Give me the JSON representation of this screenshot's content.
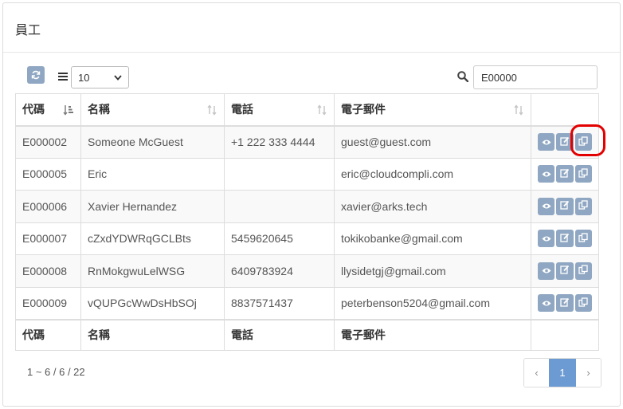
{
  "panel": {
    "title": "員工"
  },
  "toolbar": {
    "page_size": "10",
    "search_value": "E00000"
  },
  "table": {
    "columns": [
      "代碼",
      "名稱",
      "電話",
      "電子郵件"
    ],
    "rows": [
      {
        "code": "E000002",
        "name": "Someone McGuest",
        "phone": "+1 222 333 4444",
        "email": "guest@guest.com"
      },
      {
        "code": "E000005",
        "name": "Eric",
        "phone": "",
        "email": "eric@cloudcompli.com"
      },
      {
        "code": "E000006",
        "name": "Xavier Hernandez",
        "phone": "",
        "email": "xavier@arks.tech"
      },
      {
        "code": "E000007",
        "name": "cZxdYDWRqGCLBts",
        "phone": "5459620645",
        "email": "tokikobanke@gmail.com"
      },
      {
        "code": "E000008",
        "name": "RnMokgwuLelWSG",
        "phone": "6409783924",
        "email": "llysidetgj@gmail.com"
      },
      {
        "code": "E000009",
        "name": "vQUPGcWwDsHbSOj",
        "phone": "8837571437",
        "email": "peterbenson5204@gmail.com"
      }
    ]
  },
  "footer": {
    "summary": "1 ~ 6 / 6 / 22",
    "prev": "‹",
    "page": "1",
    "next": "›"
  },
  "colors": {
    "accent": "#8fa7c2",
    "active_page": "#6b9bd2",
    "highlight": "#e30000"
  }
}
